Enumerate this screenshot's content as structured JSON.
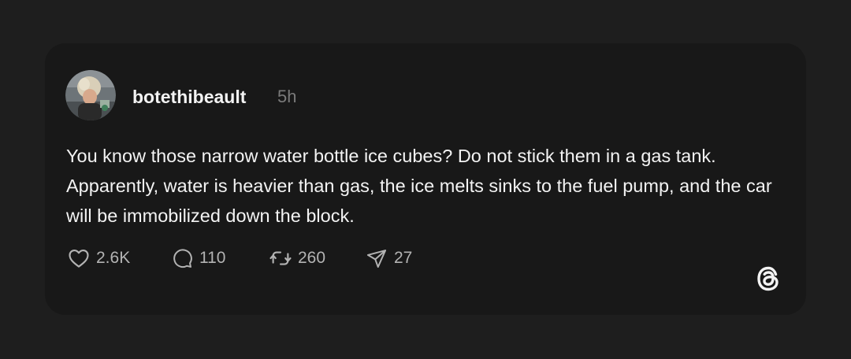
{
  "post": {
    "username": "botethibeault",
    "timestamp": "5h",
    "text": "You know those narrow water bottle ice cubes? Do not stick them in a gas tank. Apparently, water is heavier than gas, the ice melts sinks to the fuel pump, and the car will be immobilized down the block."
  },
  "actions": {
    "likes": "2.6K",
    "replies": "110",
    "reposts": "260",
    "shares": "27"
  },
  "icons": {
    "like": "heart-icon",
    "reply": "speech-bubble-icon",
    "repost": "repost-icon",
    "share": "paper-plane-icon",
    "brand": "threads-logo-icon"
  },
  "colors": {
    "page_background": "#1e1e1e",
    "card_background": "#181818",
    "primary_text": "#f3f3f3",
    "secondary_text": "#7a7a7a",
    "action_text": "#b3b3b3"
  }
}
